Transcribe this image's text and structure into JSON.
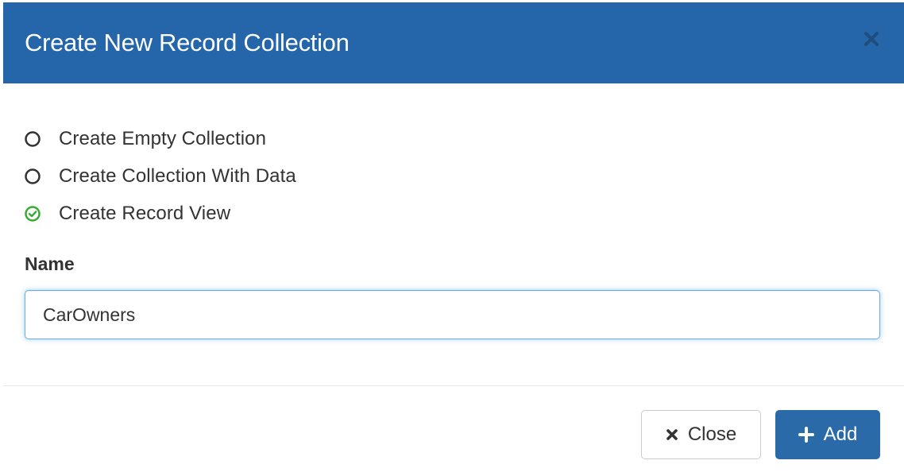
{
  "colors": {
    "header_bg": "#2565a9",
    "primary": "#2b6aa8",
    "selected_check": "#3aaa35"
  },
  "modal": {
    "title": "Create New Record Collection",
    "close_icon": "close-icon"
  },
  "options": [
    {
      "label": "Create Empty Collection",
      "selected": false,
      "icon": "radio-empty-icon"
    },
    {
      "label": "Create Collection With Data",
      "selected": false,
      "icon": "radio-empty-icon"
    },
    {
      "label": "Create Record View",
      "selected": true,
      "icon": "check-circle-icon"
    }
  ],
  "form": {
    "name_label": "Name",
    "name_value": "CarOwners"
  },
  "footer": {
    "close_label": "Close",
    "close_icon": "times-icon",
    "add_label": "Add",
    "add_icon": "plus-icon"
  }
}
